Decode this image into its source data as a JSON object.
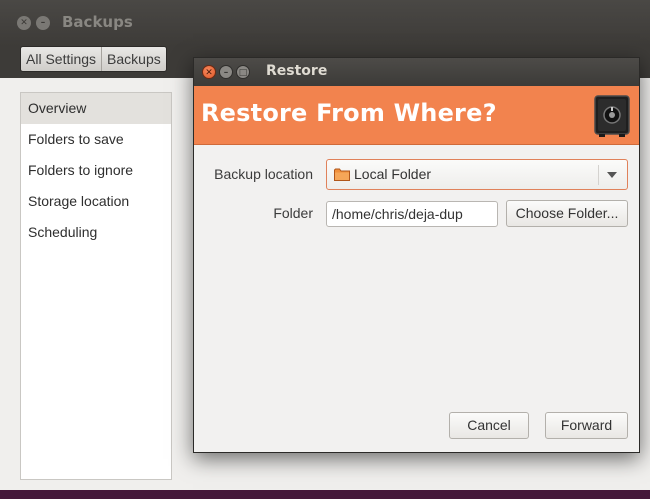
{
  "background_window": {
    "title": "Backups",
    "toolbar": {
      "buttons": [
        "All Settings",
        "Backups"
      ]
    },
    "sidebar": {
      "items": [
        {
          "label": "Overview",
          "active": true
        },
        {
          "label": "Folders to save",
          "active": false
        },
        {
          "label": "Folders to ignore",
          "active": false
        },
        {
          "label": "Storage location",
          "active": false
        },
        {
          "label": "Scheduling",
          "active": false
        }
      ]
    }
  },
  "dialog": {
    "title": "Restore",
    "heading": "Restore From Where?",
    "heading_icon": "safe-icon",
    "backup_location": {
      "label": "Backup location",
      "value": "Local Folder",
      "icon": "folder-icon"
    },
    "folder": {
      "label": "Folder",
      "value": "/home/chris/deja-dup",
      "choose_label": "Choose Folder..."
    },
    "buttons": {
      "cancel": "Cancel",
      "forward": "Forward"
    }
  },
  "colors": {
    "banner": "#f2834e",
    "accent_border": "#e0815a",
    "desktop": "#5a2134"
  }
}
